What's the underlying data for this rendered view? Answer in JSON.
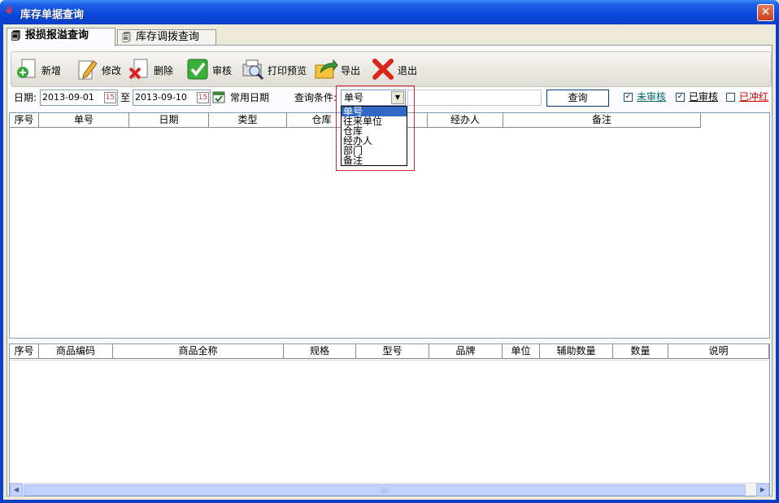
{
  "window": {
    "title": "库存单据查询",
    "close_glyph": "✕"
  },
  "tabs": [
    {
      "label": "报损报溢查询",
      "active": true
    },
    {
      "label": "库存调拨查询",
      "active": false
    }
  ],
  "toolbar": {
    "add_label": "新增",
    "edit_label": "修改",
    "delete_label": "删除",
    "audit_label": "审核",
    "print_preview_label": "打印预览",
    "export_label": "导出",
    "exit_label": "退出"
  },
  "filter": {
    "date_label": "日期:",
    "date_from": "2013-09-01",
    "to_label": "至",
    "date_to": "2013-09-10",
    "common_date_label": "常用日期",
    "query_condition_label": "查询条件:",
    "query_condition_selected": "单号",
    "query_condition_options": [
      "单号",
      "往来单位",
      "仓库",
      "经办人",
      "部门",
      "备注"
    ],
    "query_text": "",
    "query_button_label": "查询",
    "unaudited_label": "未审核",
    "unaudited_checked": true,
    "audited_label": "已审核",
    "audited_checked": true,
    "reversed_label": "已冲红",
    "reversed_checked": false
  },
  "master_grid": {
    "columns": [
      "序号",
      "单号",
      "日期",
      "类型",
      "仓库",
      "",
      "经办人",
      "备注"
    ],
    "rows": []
  },
  "detail_grid": {
    "columns": [
      "序号",
      "商品编码",
      "商品全称",
      "规格",
      "型号",
      "品牌",
      "单位",
      "辅助数量",
      "数量",
      "说明"
    ],
    "rows": []
  },
  "colors": {
    "title_bar": "#0a48da",
    "unaudited_link": "#006666",
    "audited_link": "#000000",
    "reversed_link": "#cc0000",
    "dropdown_selection": "#316ac5",
    "highlight_frame": "#d42a2a"
  },
  "icons": {
    "add": "add-plus-icon",
    "edit": "pencil-edit-icon",
    "delete": "red-x-delete-icon",
    "audit": "green-check-audit-icon",
    "print_preview": "magnifier-print-preview-icon",
    "export": "folder-arrow-export-icon",
    "exit": "red-x-exit-icon"
  }
}
